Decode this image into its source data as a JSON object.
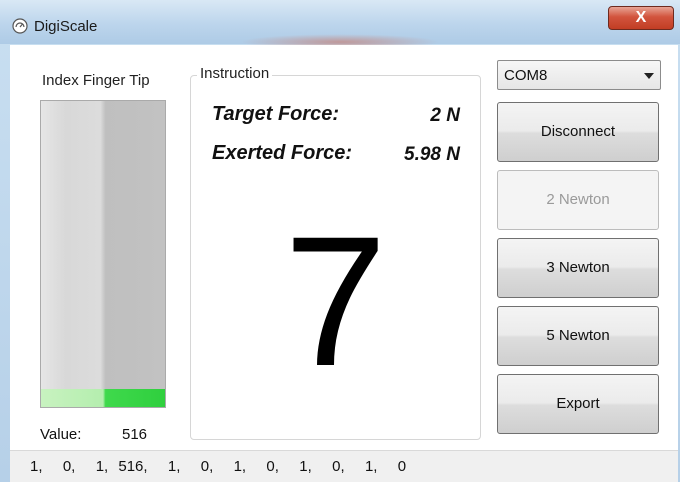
{
  "window": {
    "title": "DigiScale",
    "close_label": "X"
  },
  "left_panel": {
    "sensor_label": "Index Finger Tip",
    "level_fraction": 0.06,
    "value_label": "Value:",
    "value": "516"
  },
  "instruction": {
    "group_title": "Instruction",
    "target_force_label": "Target Force:",
    "target_force_value": "2 N",
    "exerted_force_label": "Exerted Force:",
    "exerted_force_value": "5.98 N",
    "countdown": "7"
  },
  "controls": {
    "port": {
      "selected": "COM8"
    },
    "buttons": [
      {
        "label": "Disconnect",
        "enabled": true
      },
      {
        "label": "2 Newton",
        "enabled": false
      },
      {
        "label": "3 Newton",
        "enabled": true
      },
      {
        "label": "5 Newton",
        "enabled": true
      },
      {
        "label": "Export",
        "enabled": true
      }
    ]
  },
  "status_bar": {
    "text": "1,  0,  1, 516,  1,  0,  1,  0,  1,  0,  1,  0"
  },
  "colors": {
    "gauge_fill": "#3fd94c",
    "title_bar": "#bcd5ec",
    "close_button": "#c23d24"
  },
  "icons": {
    "app_icon": "digiscale-app-icon",
    "close_icon": "close-icon",
    "dropdown_icon": "chevron-down-icon"
  }
}
